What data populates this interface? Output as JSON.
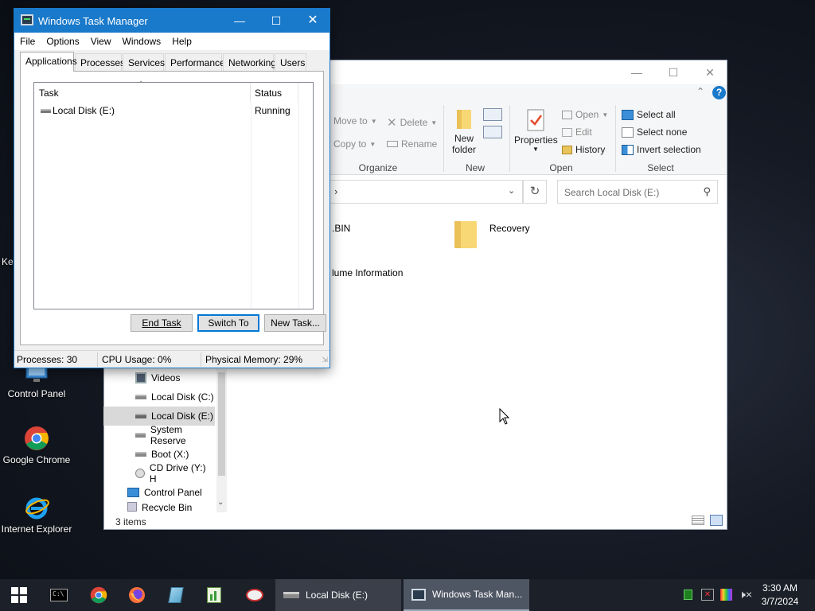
{
  "desktop": {
    "partial_label": "Key",
    "icons": [
      {
        "label": "Control Panel"
      },
      {
        "label": "Google Chrome"
      },
      {
        "label": "Internet Explorer"
      }
    ]
  },
  "explorer": {
    "ribbon": {
      "organize": {
        "move_to": "Move to",
        "copy_to": "Copy to",
        "delete": "Delete",
        "rename": "Rename",
        "label": "Organize"
      },
      "new": {
        "new_folder_line1": "New",
        "new_folder_line2": "folder",
        "label": "New"
      },
      "open": {
        "properties": "Properties",
        "open": "Open",
        "edit": "Edit",
        "history": "History",
        "label": "Open"
      },
      "select": {
        "select_all": "Select all",
        "select_none": "Select none",
        "invert_selection": "Invert selection",
        "label": "Select"
      }
    },
    "address_chevron": "›",
    "search_placeholder": "Search Local Disk (E:)",
    "files": [
      {
        "name": ".BIN"
      },
      {
        "name": "Recovery"
      },
      {
        "name": "lume Information"
      }
    ],
    "nav": [
      {
        "label": "Videos"
      },
      {
        "label": "Local Disk (C:)"
      },
      {
        "label": "Local Disk (E:)"
      },
      {
        "label": "System Reserve"
      },
      {
        "label": "Boot (X:)"
      },
      {
        "label": "CD Drive (Y:) H"
      },
      {
        "label": "Control Panel"
      },
      {
        "label": "Recycle Bin"
      }
    ],
    "status_items": "3 items"
  },
  "taskmgr": {
    "title": "Windows Task Manager",
    "menu": [
      "File",
      "Options",
      "View",
      "Windows",
      "Help"
    ],
    "tabs": [
      "Applications",
      "Processes",
      "Services",
      "Performance",
      "Networking",
      "Users"
    ],
    "columns": {
      "task": "Task",
      "status": "Status"
    },
    "rows": [
      {
        "task": "Local Disk (E:)",
        "status": "Running"
      }
    ],
    "buttons": {
      "end_task": "End Task",
      "switch_to": "Switch To",
      "new_task": "New Task..."
    },
    "status": {
      "processes": "Processes: 30",
      "cpu": "CPU Usage: 0%",
      "memory": "Physical Memory: 29%"
    }
  },
  "taskbar": {
    "tasks": [
      {
        "label": "Local Disk (E:)"
      },
      {
        "label": "Windows Task Man..."
      }
    ],
    "clock": {
      "time": "3:30 AM",
      "date": "3/7/2024"
    }
  },
  "colors": {
    "titlebar_blue": "#1979ca",
    "taskbar": "#1c2029",
    "folder_yellow": "#f8d775"
  }
}
